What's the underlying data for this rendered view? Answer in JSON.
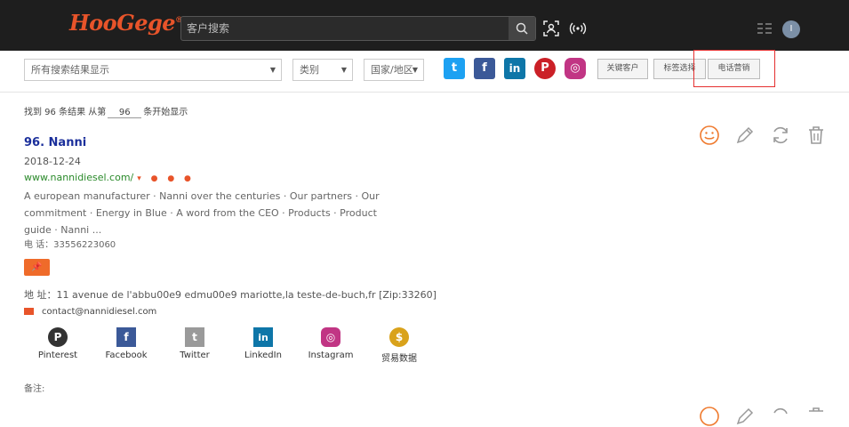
{
  "header": {
    "logo": "HooGege",
    "logo_mark": "®",
    "search_placeholder": "客户搜索",
    "avatar_letter": "I"
  },
  "filters": {
    "scope": "所有搜索结果显示",
    "type": "类别",
    "country": "国家/地区",
    "btn_extract": "关键客户",
    "btn_tag": "标签选择",
    "btn_phone": "电话营销"
  },
  "social_top": [
    {
      "name": "twitter",
      "glyph": "t",
      "color": "#1da1f2"
    },
    {
      "name": "facebook",
      "glyph": "f",
      "color": "#3b5998"
    },
    {
      "name": "linkedin",
      "glyph": "in",
      "color": "#0e76a8"
    },
    {
      "name": "pinterest",
      "glyph": "P",
      "color": "#cb2027"
    },
    {
      "name": "instagram",
      "glyph": "◎",
      "color": "#c13584"
    }
  ],
  "results_info": {
    "prefix": "找到 96 条结果",
    "from": "从第",
    "start": "96",
    "suffix": "条开始显示"
  },
  "result": {
    "title": "96. Nanni",
    "date": "2018-12-24",
    "url": "www.nannidiesel.com/",
    "url_extra": "▾ ● ● ●",
    "description": "A european manufacturer · Nanni over the centuries · Our partners · Our commitment · Energy in Blue · A word from the CEO · Products · Product guide · Nanni ...",
    "phone": "电 话：33556223060",
    "pin_label": "📌",
    "address": "地 址：11 avenue de l'abbu00e9 edmu00e9 mariotte,la teste-de-buch,fr [Zip:33260]",
    "email": "contact@nannidiesel.com",
    "remark": "备注:"
  },
  "social_links": [
    {
      "label": "Pinterest",
      "glyph": "P",
      "color": "#cb2027",
      "icon": "pinterest-icon"
    },
    {
      "label": "Facebook",
      "glyph": "f",
      "color": "#3b5998",
      "icon": "facebook-icon"
    },
    {
      "label": "Twitter",
      "glyph": "t",
      "color": "#9a9a9a",
      "icon": "twitter-icon"
    },
    {
      "label": "LinkedIn",
      "glyph": "in",
      "color": "#0e76a8",
      "icon": "linkedin-icon"
    },
    {
      "label": "Instagram",
      "glyph": "◎",
      "color": "#c13584",
      "icon": "instagram-icon"
    },
    {
      "label": "贸易数据",
      "glyph": "$",
      "color": "#d9a21b",
      "icon": "trade-data-icon"
    }
  ],
  "colors": {
    "accent": "#e8542a",
    "title_blue": "#1b2f9b",
    "url_green": "#2a8a2a",
    "highlight_red": "#e53030"
  }
}
